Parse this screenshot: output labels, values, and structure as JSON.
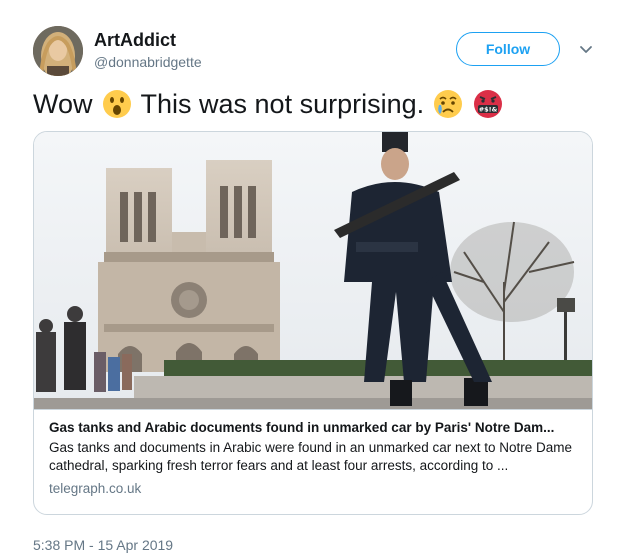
{
  "user": {
    "display_name": "ArtAddict",
    "handle": "@donnabridgette"
  },
  "follow_button": {
    "label": "Follow"
  },
  "tweet": {
    "text_part1": "Wow",
    "text_part2": "This was not surprising.",
    "emojis": [
      "astonished-face-emoji",
      "crying-face-emoji",
      "cursing-face-emoji"
    ],
    "cursing_symbols": "#$!&"
  },
  "card": {
    "title": "Gas tanks and Arabic documents found in unmarked car by Paris' Notre Dam...",
    "description": "Gas tanks and documents in Arabic were found in an unmarked car next to Notre Dame cathedral, sparking fresh terror fears and at least four arrests, according to ...",
    "domain": "telegraph.co.uk",
    "image_subject": "notre-dame-and-armed-officer-photo"
  },
  "timestamp": "5:38 PM - 15 Apr 2019",
  "colors": {
    "accent": "#1da1f2",
    "secondary_text": "#657786",
    "border": "#ccd6dd"
  }
}
